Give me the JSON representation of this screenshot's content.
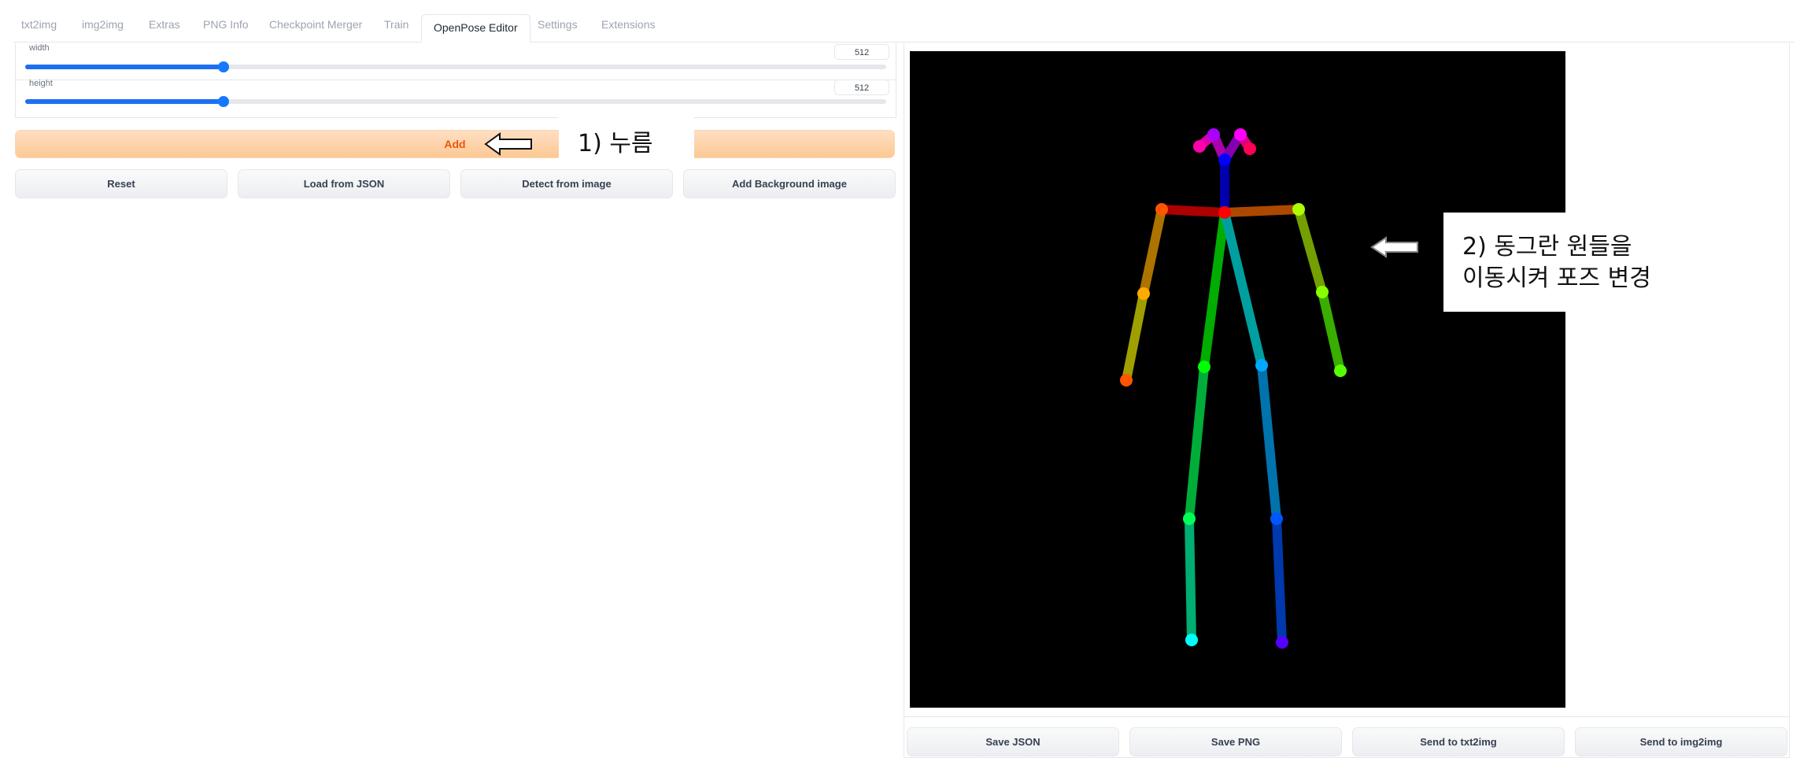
{
  "tabs": [
    "txt2img",
    "img2img",
    "Extras",
    "PNG Info",
    "Checkpoint Merger",
    "Train",
    "OpenPose Editor",
    "Settings",
    "Extensions"
  ],
  "active_tab": "OpenPose Editor",
  "sliders": {
    "width": {
      "label": "width",
      "value": "512",
      "fraction": 0.23
    },
    "height": {
      "label": "height",
      "value": "512",
      "fraction": 0.23
    }
  },
  "buttons": {
    "add": "Add",
    "reset": "Reset",
    "load_json": "Load from JSON",
    "detect": "Detect from image",
    "add_bg": "Add Background image",
    "save_json": "Save JSON",
    "save_png": "Save PNG",
    "send_txt2img": "Send to txt2img",
    "send_img2img": "Send to img2img"
  },
  "annotations": {
    "step1": "1) 누름",
    "step2_line1": "2) 동그란 원들을",
    "step2_line2": "이동시켜 포즈 변경"
  },
  "colors": {
    "accent_orange": "#ea580c",
    "slider_blue": "#1677ff",
    "canvas_bg": "#000000"
  }
}
